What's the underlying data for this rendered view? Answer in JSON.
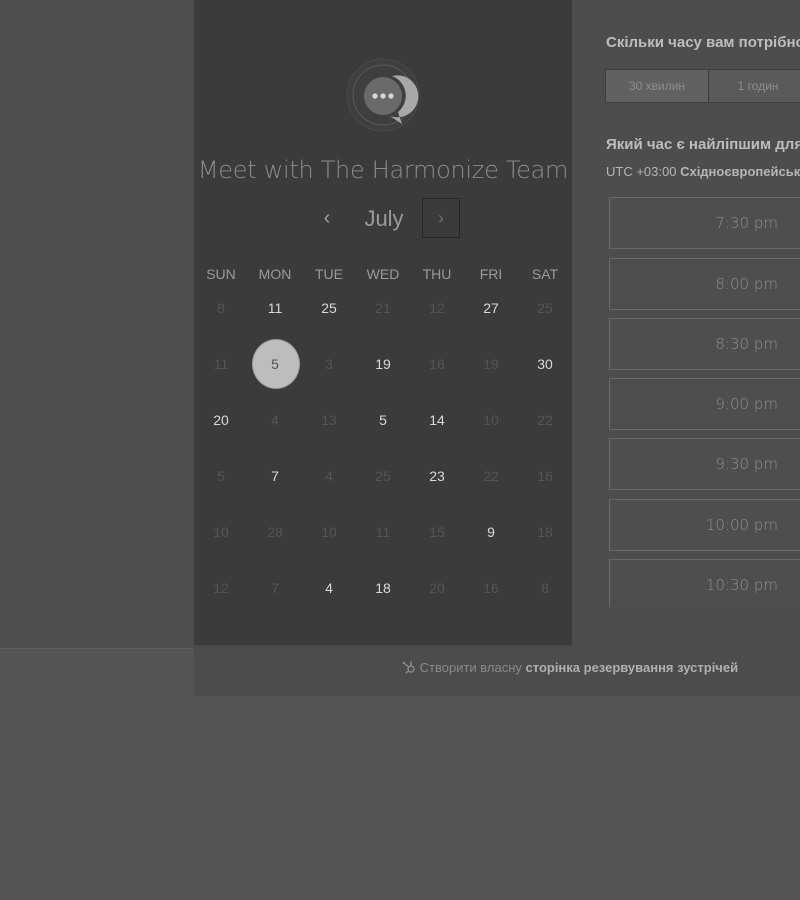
{
  "calendar": {
    "title": "Meet with The Harmonize Team",
    "month": "July",
    "prev_icon": "‹",
    "next_icon": "›",
    "weekdays": [
      "SUN",
      "MON",
      "TUE",
      "WED",
      "THU",
      "FRI",
      "SAT"
    ],
    "weeks": [
      [
        "8",
        "11",
        "25",
        "21",
        "12",
        "27",
        "25"
      ],
      [
        "11",
        "5",
        "3",
        "19",
        "16",
        "19",
        "30"
      ],
      [
        "20",
        "4",
        "13",
        "5",
        "14",
        "10",
        "22"
      ],
      [
        "5",
        "7",
        "4",
        "25",
        "23",
        "22",
        "16"
      ],
      [
        "10",
        "28",
        "10",
        "11",
        "15",
        "9",
        "18"
      ],
      [
        "12",
        "7",
        "4",
        "18",
        "20",
        "16",
        "8"
      ]
    ],
    "available": [
      [
        false,
        true,
        true,
        false,
        false,
        true,
        false
      ],
      [
        false,
        true,
        false,
        true,
        false,
        false,
        true
      ],
      [
        true,
        false,
        false,
        true,
        true,
        false,
        false
      ],
      [
        false,
        true,
        false,
        false,
        true,
        false,
        false
      ],
      [
        false,
        false,
        false,
        false,
        false,
        true,
        false
      ],
      [
        false,
        false,
        true,
        true,
        false,
        false,
        false
      ]
    ],
    "selected": {
      "week": 1,
      "day": 1
    }
  },
  "duration": {
    "question": "Скільки часу вам потрібно",
    "options": [
      "30 хвилин",
      "1 годин"
    ],
    "active": 0
  },
  "time": {
    "question": "Який час є найліпшим для",
    "timezone_offset": "UTC +03:00",
    "timezone_name": "Східноєвропейськ",
    "slots": [
      "7:30 pm",
      "8:00 pm",
      "8:30 pm",
      "9:00 pm",
      "9:30 pm",
      "10:00 pm",
      "10:30 pm"
    ]
  },
  "footer": {
    "prefix": "Створити власну",
    "link": "сторінка резервування зустрічей"
  },
  "colors": {
    "panel_bg": "#3b3b3b",
    "selected_day": "#bdbdbd",
    "overlay": "#4d4d4d"
  },
  "icons": {
    "avatar": "chat-bubble-logo-icon",
    "footer": "hubspot-sprocket-icon"
  }
}
